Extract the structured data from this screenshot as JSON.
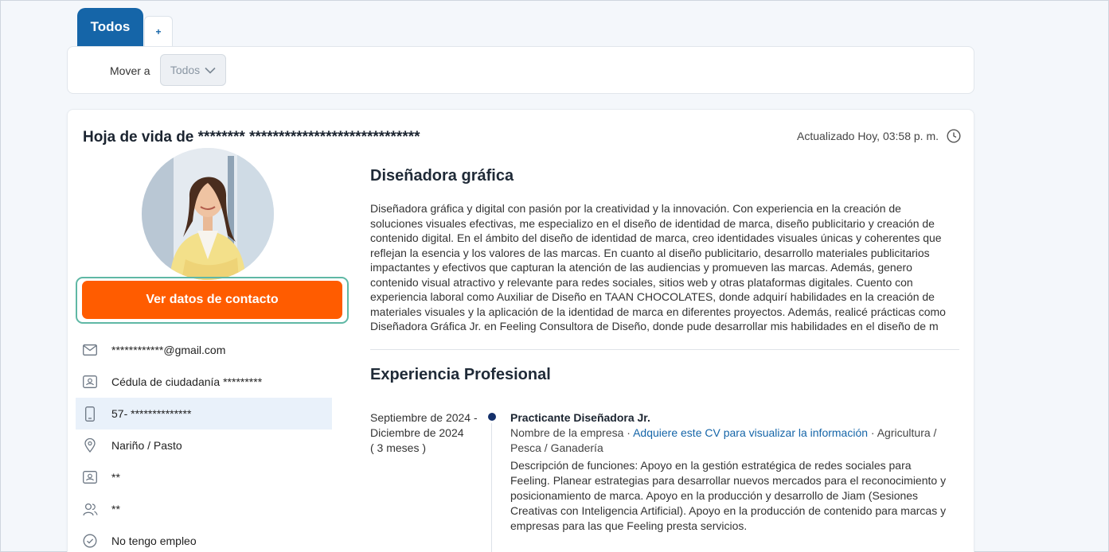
{
  "tabs": {
    "active": "Todos",
    "add": "+"
  },
  "move_bar": {
    "label": "Mover a",
    "selected": "Todos"
  },
  "cv": {
    "title": "Hoja de vida de ******** *****************************",
    "updated": "Actualizado Hoy, 03:58 p. m.",
    "contact_button": "Ver datos de contacto"
  },
  "info_items": [
    {
      "icon": "mail-icon",
      "text": "************@gmail.com"
    },
    {
      "icon": "id-card-icon",
      "text": "Cédula de ciudadanía *********"
    },
    {
      "icon": "phone-icon",
      "text": "57- **************"
    },
    {
      "icon": "location-pin-icon",
      "text": "Nariño / Pasto"
    },
    {
      "icon": "id-card-icon",
      "text": "**"
    },
    {
      "icon": "people-icon",
      "text": "**"
    },
    {
      "icon": "check-circle-icon",
      "text": "No tengo empleo"
    }
  ],
  "profile": {
    "headline": "Diseñadora gráfica",
    "summary": "Diseñadora gráfica y digital con pasión por la creatividad y la innovación. Con experiencia en la creación de soluciones visuales efectivas, me especializo en el diseño de identidad de marca, diseño publicitario y creación de contenido digital. En el ámbito del diseño de identidad de marca, creo identidades visuales únicas y coherentes que reflejan la esencia y los valores de las marcas. En cuanto al diseño publicitario, desarrollo materiales publicitarios impactantes y efectivos que capturan la atención de las audiencias y promueven las marcas. Además, genero contenido visual atractivo y relevante para redes sociales, sitios web y otras plataformas digitales. Cuento con experiencia laboral como Auxiliar de Diseño en TAAN CHOCOLATES, donde adquirí habilidades en la creación de materiales visuales y la aplicación de la identidad de marca en diferentes proyectos. Además, realicé prácticas como Diseñadora Gráfica Jr. en Feeling Consultora de Diseño, donde pude desarrollar mis habilidades en el diseño de m"
  },
  "experience": {
    "section_title": "Experiencia Profesional",
    "items": [
      {
        "dates": "Septiembre de 2024 - Diciembre de 2024",
        "duration": "( 3 meses )",
        "role": "Practicante Diseñadora Jr.",
        "company": "Nombre de la empresa",
        "company_link": "Adquiere este CV para visualizar la información",
        "sector": "Agricultura / Pesca / Ganadería",
        "separator": "·",
        "description": "Descripción de funciones: Apoyo en la gestión estratégica de redes sociales para Feeling. Planear estrategias para desarrollar nuevos mercados para el reconocimiento y posicionamiento de marca. Apoyo en la producción y desarrollo de Jiam (Sesiones Creativas con Inteligencia Artificial). Apoyo en la producción de contenido para marcas y empresas para las que Feeling presta servicios."
      }
    ]
  },
  "colors": {
    "primary": "#1565a8",
    "cta": "#ff5c00",
    "highlight_border": "#5fb8a5"
  }
}
